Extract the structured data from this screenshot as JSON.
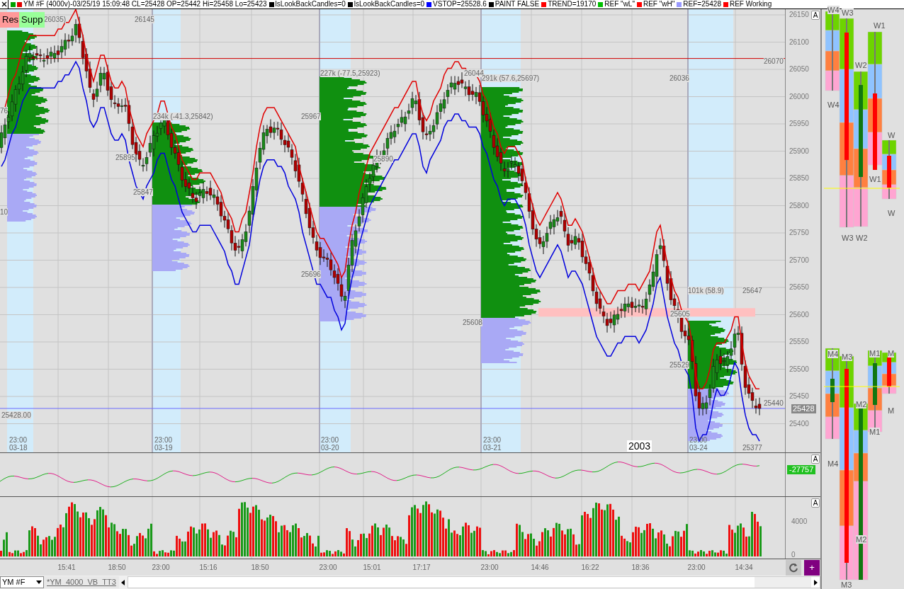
{
  "legend": [
    {
      "text": "YM #F (4000v)-03/25/19 15:09:48 CL=25428 OP=25442 Hi=25458 Lo=25423",
      "swatches": [
        {
          "color": "#00a000"
        },
        {
          "color": "#e00000"
        }
      ]
    },
    {
      "text": "lsLookBackCandles=0",
      "swatches": [
        {
          "color": "#000000"
        }
      ]
    },
    {
      "text": "lsLookBackCandles=0",
      "swatches": [
        {
          "color": "#000000"
        }
      ]
    },
    {
      "text": "VSTOP=25528.6",
      "swatches": [
        {
          "color": "#0000ff"
        }
      ]
    },
    {
      "text": "PAINT FALSE",
      "swatches": [
        {
          "color": "#000000"
        }
      ]
    },
    {
      "text": "TREND=19170",
      "swatches": [
        {
          "color": "#ff0000"
        }
      ]
    },
    {
      "text": "REF \"wL\"",
      "swatches": [
        {
          "color": "#00c000"
        }
      ]
    },
    {
      "text": "REF \"wH\"",
      "swatches": [
        {
          "color": "#ff0000"
        }
      ]
    },
    {
      "text": "REF=25428",
      "swatches": [
        {
          "color": "#9999ff"
        }
      ]
    },
    {
      "text": "REF Working",
      "swatches": [
        {
          "color": "#ff0000"
        }
      ]
    }
  ],
  "quick_buttons": [
    {
      "label": "Res",
      "color": "#ff9999"
    },
    {
      "label": "Supp",
      "color": "#99ff99"
    }
  ],
  "price_axis": {
    "ticks": [
      "26150",
      "26100",
      "26050",
      "26000",
      "25950",
      "25900",
      "25850",
      "25800",
      "25750",
      "25700",
      "25650",
      "25600",
      "25550",
      "25500",
      "25450",
      "25400"
    ],
    "current_price": "25428",
    "scale_button": "A"
  },
  "annotations": [
    "26035)",
    "26145",
    "227k (-77.5,25923)",
    "26044",
    "291k (57.6,25697)",
    "26036",
    "26070",
    "234k (-41.3,25842)",
    "25967",
    "25895",
    "25890",
    "25847",
    "76",
    "10",
    "25696",
    "25608",
    "25605",
    "101k (58.9)",
    "25647",
    "25529",
    "25440",
    "25428.00",
    "25377"
  ],
  "sessions": [
    {
      "time": "23:00",
      "date": "03-18"
    },
    {
      "time": "23:00",
      "date": "03-19"
    },
    {
      "time": "23:00",
      "date": "03-20"
    },
    {
      "time": "23:00",
      "date": "03-21"
    },
    {
      "time": "23:00",
      "date": "03-24"
    }
  ],
  "bar_count": "2003",
  "indicator": {
    "value": "-27757",
    "scale_button": "A"
  },
  "volume": {
    "ticks": [
      "4000",
      "0"
    ],
    "scale_button": "A"
  },
  "time_axis": [
    "15:41",
    "18:50",
    "23:00",
    "15:16",
    "18:50",
    "23:00",
    "15:01",
    "17:17",
    "23:00",
    "14:46",
    "16:22",
    "18:36",
    "23:00",
    "14:34"
  ],
  "bottom_bar": {
    "symbol": "YM #F",
    "tab": "*YM_4000_VB_TT3",
    "add_button": "+"
  },
  "side_panel": {
    "weekly_labels": [
      "W4",
      "W3",
      "W1",
      "W2",
      "W4",
      "W",
      "W1",
      "W",
      "W3",
      "W2"
    ],
    "monthly_labels": [
      "M4",
      "M3",
      "M1",
      "M",
      "M2",
      "M",
      "M1",
      "M4",
      "M2",
      "M3"
    ]
  }
}
